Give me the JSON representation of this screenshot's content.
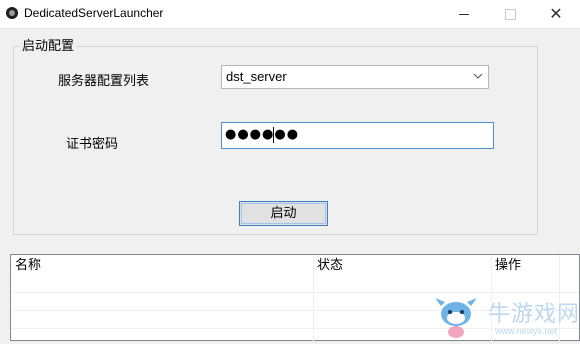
{
  "window": {
    "title": "DedicatedServerLauncher",
    "icon": "app-icon",
    "controls": [
      "minimize",
      "maximize",
      "close"
    ]
  },
  "launch_group": {
    "legend": "启动配置",
    "server_list": {
      "label": "服务器配置列表",
      "selected": "dst_server"
    },
    "password": {
      "label": "证书密码",
      "masked_value": "●●●●●●"
    },
    "start_button": "启动"
  },
  "table": {
    "columns": [
      "名称",
      "状态",
      "操作"
    ],
    "rows": []
  },
  "watermark": {
    "text": "牛游戏网",
    "url": "www.newyx.net"
  },
  "colors": {
    "focus_border": "#4a90d9",
    "button_border": "#3c7fc8",
    "watermark": "#bcd8f0"
  }
}
